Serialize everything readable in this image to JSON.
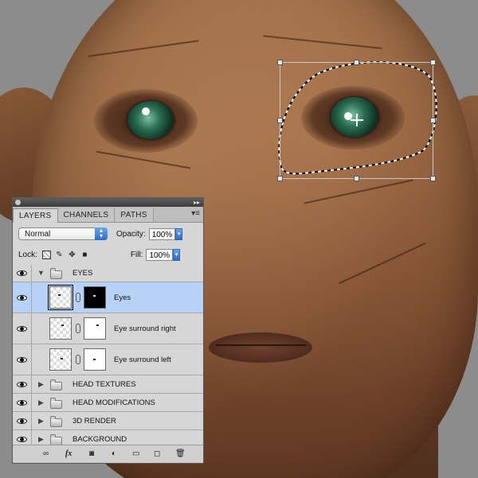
{
  "panel": {
    "tabs": [
      "LAYERS",
      "CHANNELS",
      "PATHS"
    ],
    "menu_icon": "panel-menu-icon",
    "blend_mode": "Normal",
    "opacity_label": "Opacity:",
    "opacity_value": "100%",
    "lock_label": "Lock:",
    "fill_label": "Fill:",
    "fill_value": "100%"
  },
  "layers": [
    {
      "name": "EYES",
      "type": "group",
      "expanded": true,
      "visible": true
    },
    {
      "name": "Eyes",
      "type": "layer",
      "selected": true,
      "visible": true,
      "mask": "black"
    },
    {
      "name": "Eye surround right",
      "type": "layer",
      "selected": false,
      "visible": true,
      "mask": "white"
    },
    {
      "name": "Eye surround left",
      "type": "layer",
      "selected": false,
      "visible": true,
      "mask": "white"
    },
    {
      "name": "HEAD TEXTURES",
      "type": "group",
      "expanded": false,
      "visible": true
    },
    {
      "name": "HEAD MODIFICATIONS",
      "type": "group",
      "expanded": false,
      "visible": true
    },
    {
      "name": "3D RENDER",
      "type": "group",
      "expanded": false,
      "visible": true
    },
    {
      "name": "BACKGROUND",
      "type": "group",
      "expanded": false,
      "visible": true
    }
  ],
  "bottom_icons": [
    "link-layers-icon",
    "fx-icon",
    "add-mask-icon",
    "adjustment-layer-icon",
    "new-group-icon",
    "new-layer-icon",
    "trash-icon"
  ],
  "bottom_labels": {
    "fx": "fx"
  },
  "colors": {
    "selected_row": "#b7d2f7",
    "panel_bg": "#d6d6d6",
    "accent_blue": "#2d6ec8"
  }
}
